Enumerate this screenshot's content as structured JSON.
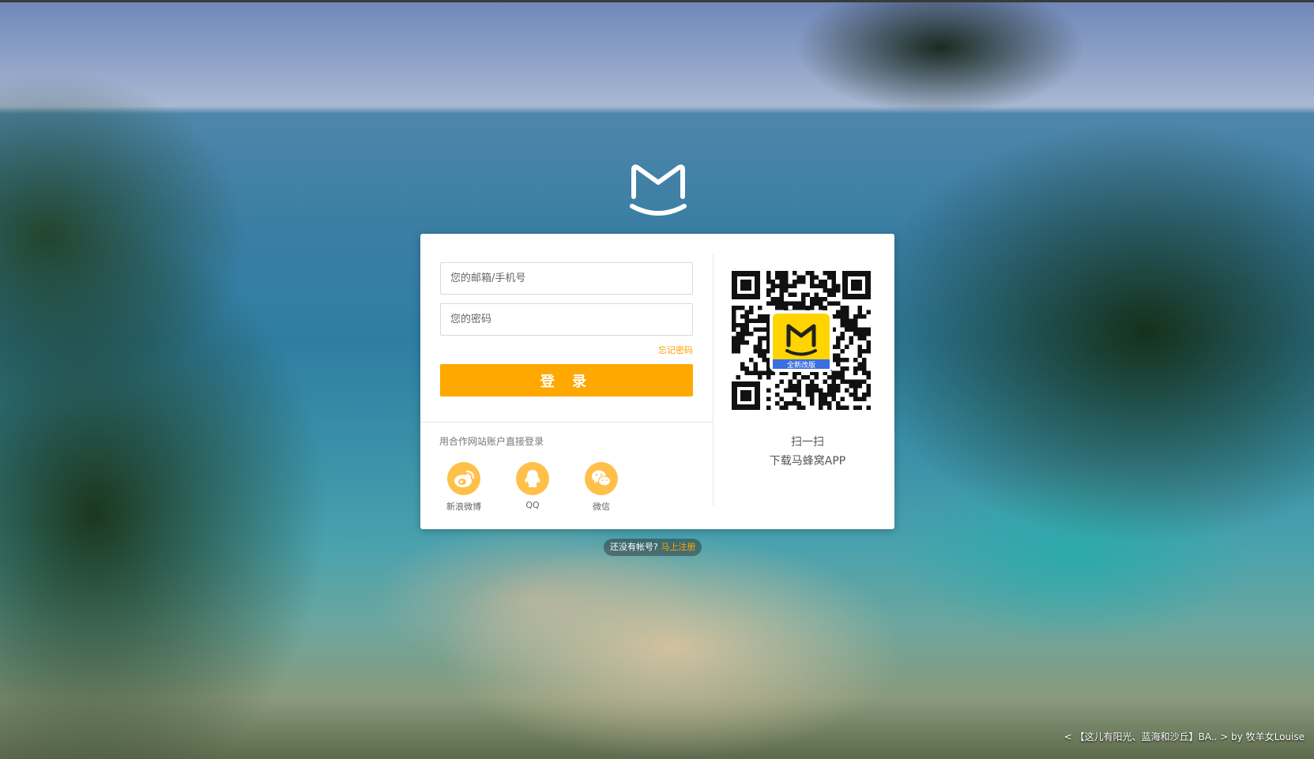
{
  "colors": {
    "accent": "#ffa800",
    "social_icon_bg": "#ffc04a",
    "card_bg": "#ffffff"
  },
  "logo": {
    "icon": "mafengwo-logo-icon"
  },
  "login": {
    "email_placeholder": "您的邮箱/手机号",
    "password_placeholder": "您的密码",
    "forgot_label": "忘记密码",
    "submit_label": "登 录"
  },
  "partner": {
    "title": "用合作网站账户直接登录",
    "items": [
      {
        "label": "新浪微博",
        "icon": "weibo-icon"
      },
      {
        "label": "QQ",
        "icon": "qq-icon"
      },
      {
        "label": "微信",
        "icon": "wechat-icon"
      }
    ]
  },
  "app": {
    "qr_badge": "全新改版",
    "scan_line1": "扫一扫",
    "scan_line2": "下载马蜂窝APP"
  },
  "register": {
    "prompt": "还没有帐号?",
    "link": "马上注册"
  },
  "credit": {
    "prefix": "<",
    "title": "【这儿有阳光、蓝海和沙丘】BA..",
    "suffix": "> by 牧羊女Louise"
  }
}
